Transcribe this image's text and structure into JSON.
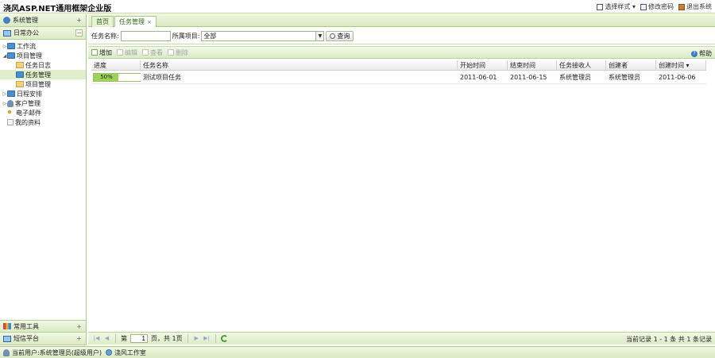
{
  "app": {
    "title": "浇风ASP.NET通用框架企业版"
  },
  "header": {
    "links": [
      {
        "label": "选择样式 ▾",
        "icon": "theme-icon"
      },
      {
        "label": "修改密码",
        "icon": "password-icon"
      },
      {
        "label": "退出系统",
        "icon": "logout-icon"
      }
    ]
  },
  "sidebar": {
    "system_label": "系统管理",
    "office_label": "日常办公",
    "tools_label": "常用工具",
    "sms_label": "短信平台",
    "tree": [
      {
        "label": "工作流",
        "level": 0,
        "arrow": "▷"
      },
      {
        "label": "项目管理",
        "level": 0,
        "arrow": "◢"
      },
      {
        "label": "任务日志",
        "level": 1
      },
      {
        "label": "任务管理",
        "level": 1
      },
      {
        "label": "项目管理",
        "level": 1
      },
      {
        "label": "日程安排",
        "level": 0,
        "arrow": "▷"
      },
      {
        "label": "客户管理",
        "level": 0,
        "arrow": "▷"
      },
      {
        "label": "电子邮件",
        "level": 0
      },
      {
        "label": "我的资料",
        "level": 0
      }
    ]
  },
  "tabs": [
    {
      "label": "首页"
    },
    {
      "label": "任务管理",
      "close": "×"
    }
  ],
  "search": {
    "task_name_label": "任务名称:",
    "task_name_value": "",
    "project_label": "所属项目:",
    "project_value": "全部",
    "query_label": "查询"
  },
  "toolbar": {
    "add": "增加",
    "edit": "编辑",
    "view": "查看",
    "delete": "删除",
    "help": "帮助"
  },
  "grid": {
    "columns": [
      "进度",
      "任务名称",
      "开始时间",
      "结束时间",
      "任务接收人",
      "创建者",
      "创建时间 ▾"
    ],
    "rows": [
      {
        "progress": 0.5,
        "progress_text": "50%",
        "name": "测试项目任务",
        "start": "2011-06-01",
        "end": "2011-06-15",
        "receiver": "系统管理员",
        "creator": "系统管理员",
        "created": "2011-06-06"
      }
    ]
  },
  "pager": {
    "page_prefix": "第",
    "page_value": "1",
    "page_suffix": "页，共 1页",
    "info": "当前记录 1 - 1 条  共 1 条记录"
  },
  "status": {
    "user": "当前用户:系统管理员(超级用户)",
    "studio": "浇风工作室"
  }
}
